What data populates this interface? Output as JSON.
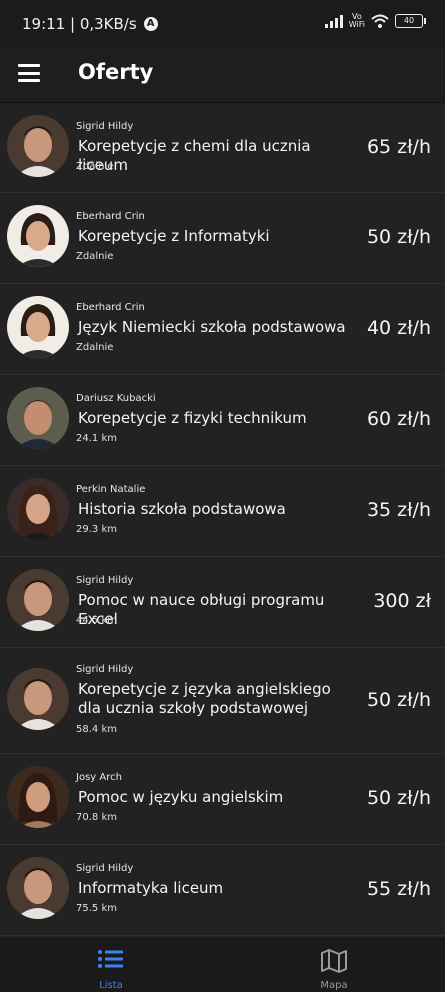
{
  "status": {
    "time_speed": "19:11 | 0,3KB/s",
    "badge": "A",
    "vowifi": "Vo\nWiFi",
    "battery": "40"
  },
  "appbar": {
    "menu_icon": "hamburger-menu-icon",
    "title": "Oferty"
  },
  "offers": [
    {
      "author": "Sigrid Hildy",
      "title": "Korepetycje z chemi dla ucznia liceum",
      "meta": "Zdalnie",
      "price": "65 zł/h",
      "avatar": "man-a"
    },
    {
      "author": "Eberhard Crin",
      "title": "Korepetycje z Informatyki",
      "meta": "Zdalnie",
      "price": "50 zł/h",
      "avatar": "woman-a"
    },
    {
      "author": "Eberhard Crin",
      "title": "Język Niemiecki szkoła podstawowa",
      "meta": "Zdalnie",
      "price": "40 zł/h",
      "avatar": "woman-a"
    },
    {
      "author": "Dariusz Kubacki",
      "title": "Korepetycje z fizyki technikum",
      "meta": "24.1 km",
      "price": "60 zł/h",
      "avatar": "man-b"
    },
    {
      "author": "Perkin Natalie",
      "title": "Historia szkoła podstawowa",
      "meta": "29.3 km",
      "price": "35 zł/h",
      "avatar": "woman-b"
    },
    {
      "author": "Sigrid Hildy",
      "title": "Pomoc w nauce obługi programu Excel",
      "meta": "44.5 km",
      "price": "300 zł",
      "avatar": "man-a"
    },
    {
      "author": "Sigrid Hildy",
      "title": "Korepetycje z języka angielskiego dla ucznia szkoły podstawowej",
      "meta": "58.4 km",
      "price": "50 zł/h",
      "avatar": "man-a"
    },
    {
      "author": "Josy Arch",
      "title": "Pomoc w języku angielskim",
      "meta": "70.8 km",
      "price": "50 zł/h",
      "avatar": "woman-c"
    },
    {
      "author": "Sigrid Hildy",
      "title": "Informatyka liceum",
      "meta": "75.5 km",
      "price": "55 zł/h",
      "avatar": "man-a"
    }
  ],
  "bottom_nav": {
    "list_label": "Lista",
    "list_icon": "list-icon",
    "map_label": "Mapa",
    "map_icon": "map-icon",
    "active_color": "#3b82f6",
    "inactive_color": "#9a9a9a"
  },
  "colors": {
    "background": "#222222",
    "appbar": "#1e1e1e",
    "divider": "#2f2f2f"
  }
}
